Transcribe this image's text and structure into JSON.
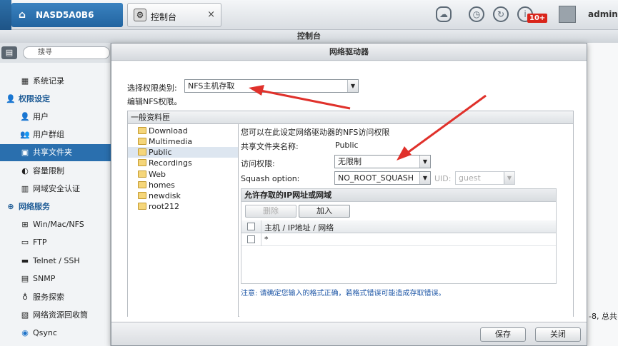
{
  "topbar": {
    "device_name": "NASD5A0B6",
    "app_tab_label": "控制台",
    "close_glyph": "×",
    "notification_badge": "10+",
    "user": "admin"
  },
  "window_title": "控制台",
  "sidebar": {
    "search_placeholder": "搜寻",
    "items": [
      {
        "label": "系统记录",
        "icon": "log-icon"
      },
      {
        "label": "权限设定",
        "icon": "user-settings-icon",
        "header": true
      },
      {
        "label": "用户",
        "icon": "user-icon"
      },
      {
        "label": "用户群组",
        "icon": "user-group-icon"
      },
      {
        "label": "共享文件夹",
        "icon": "folder-share-icon",
        "active": true
      },
      {
        "label": "容量限制",
        "icon": "quota-icon"
      },
      {
        "label": "网域安全认证",
        "icon": "domain-auth-icon"
      },
      {
        "label": "网络服务",
        "icon": "network-service-icon",
        "header": true
      },
      {
        "label": "Win/Mac/NFS",
        "icon": "win-mac-nfs-icon"
      },
      {
        "label": "FTP",
        "icon": "ftp-icon"
      },
      {
        "label": "Telnet / SSH",
        "icon": "terminal-icon"
      },
      {
        "label": "SNMP",
        "icon": "snmp-icon"
      },
      {
        "label": "服务探索",
        "icon": "service-discovery-icon"
      },
      {
        "label": "网络资源回收筒",
        "icon": "recycle-bin-icon"
      },
      {
        "label": "Qsync",
        "icon": "qsync-icon"
      }
    ]
  },
  "background_right_text": "-8, 总共",
  "dialog": {
    "title": "网络驱动器",
    "type_label": "选择权限类别:",
    "type_value": "NFS主机存取",
    "edit_note": "编辑NFS权限。",
    "group_title": "一般资料匣",
    "folders": [
      "Download",
      "Multimedia",
      "Public",
      "Recordings",
      "Web",
      "homes",
      "newdisk",
      "root212"
    ],
    "selected_folder": "Public",
    "panel": {
      "intro": "您可以在此设定网络驱动器的NFS访问权限",
      "share_name_label": "共享文件夹名称:",
      "share_name_value": "Public",
      "access_label": "访问权限:",
      "access_value": "无限制",
      "squash_label": "Squash option:",
      "squash_value": "NO_ROOT_SQUASH",
      "uid_label": "UID:",
      "uid_value": "guest",
      "ip_box_title": "允许存取的IP网址或网域",
      "delete_button": "删除",
      "add_button": "加入",
      "col_header": "主机 / IP地址 / 网络",
      "rows": [
        "*"
      ],
      "warning": "注意: 请确定您输入的格式正确，若格式错误可能造成存取错误。"
    },
    "save_button": "保存",
    "close_button": "关闭"
  },
  "colors": {
    "accent": "#2a6fae",
    "arrow": "#e0312b",
    "warning_text": "#1d56a6"
  }
}
